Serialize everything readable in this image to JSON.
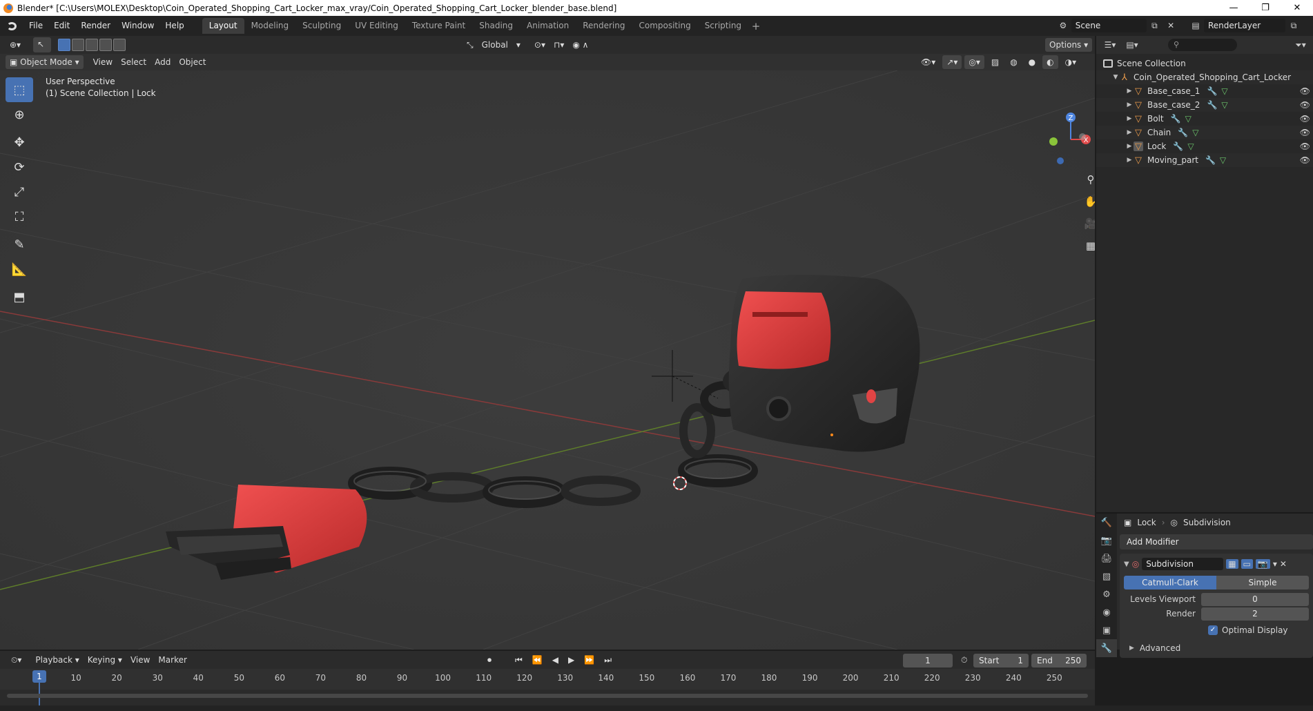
{
  "window": {
    "title": "Blender* [C:\\Users\\MOLEX\\Desktop\\Coin_Operated_Shopping_Cart_Locker_max_vray/Coin_Operated_Shopping_Cart_Locker_blender_base.blend]",
    "minimize": "—",
    "restore": "❐",
    "close": "✕"
  },
  "menu": [
    "File",
    "Edit",
    "Render",
    "Window",
    "Help"
  ],
  "workspaces": [
    {
      "label": "Layout",
      "active": true
    },
    {
      "label": "Modeling"
    },
    {
      "label": "Sculpting"
    },
    {
      "label": "UV Editing"
    },
    {
      "label": "Texture Paint"
    },
    {
      "label": "Shading"
    },
    {
      "label": "Animation"
    },
    {
      "label": "Rendering"
    },
    {
      "label": "Compositing"
    },
    {
      "label": "Scripting"
    }
  ],
  "scene": {
    "name": "Scene",
    "render_layer": "RenderLayer"
  },
  "viewport": {
    "transform_orientation": "Global",
    "options_label": "Options",
    "mode": "Object Mode",
    "header_menus": [
      "View",
      "Select",
      "Add",
      "Object"
    ],
    "overlay_line1": "User Perspective",
    "overlay_line2": "(1) Scene Collection | Lock",
    "gizmo_axes": {
      "x": "X",
      "z": "Z"
    }
  },
  "outliner": {
    "root": "Scene Collection",
    "collection": "Coin_Operated_Shopping_Cart_Locker",
    "objects": [
      "Base_case_1",
      "Base_case_2",
      "Bolt",
      "Chain",
      "Lock",
      "Moving_part"
    ],
    "selected": "Lock"
  },
  "properties": {
    "object": "Lock",
    "modifier_crumb": "Subdivision",
    "add_modifier": "Add Modifier",
    "modifier_name": "Subdivision",
    "method_options": [
      "Catmull-Clark",
      "Simple"
    ],
    "method_selected": "Catmull-Clark",
    "levels_viewport_label": "Levels Viewport",
    "levels_viewport": "0",
    "render_label": "Render",
    "render": "2",
    "optimal_display": "Optimal Display",
    "advanced": "Advanced"
  },
  "timeline": {
    "menus": [
      "Playback",
      "Keying",
      "View",
      "Marker"
    ],
    "current_frame": "1",
    "start_label": "Start",
    "start": "1",
    "end_label": "End",
    "end": "250",
    "ticks": [
      "10",
      "20",
      "30",
      "40",
      "50",
      "60",
      "70",
      "80",
      "90",
      "100",
      "110",
      "120",
      "130",
      "140",
      "150",
      "160",
      "170",
      "180",
      "190",
      "200",
      "210",
      "220",
      "230",
      "240",
      "250"
    ]
  },
  "colors": {
    "accent": "#4772b3",
    "object_red": "#d93a3a",
    "axis_x": "#c44a4a",
    "axis_y": "#6b8f2f"
  }
}
